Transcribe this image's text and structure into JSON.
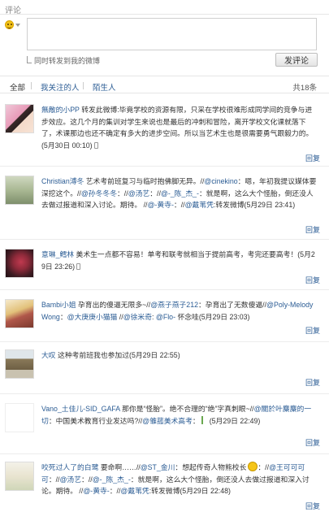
{
  "header": {
    "title": "评论"
  },
  "composer": {
    "placeholder": "",
    "forward_label": "同时转发到我的微博",
    "submit_label": "发评论"
  },
  "filters": {
    "all": "全部",
    "following": "我关注的人",
    "strangers": "陌生人",
    "total": "共18条"
  },
  "reply_label": "回复",
  "comments": [
    {
      "user": "無敵的小PP",
      "text": " 转发此微博:毕竟学校的资源有限，只采在学校很难形成同学间的竞争与进步效应。这几个月的集训对学生来说也是最后的冲刺和冒险，离开学校文化课就落下了，术课那边也还不确定有多大的进步空间。所以当艺术生也是很需要勇气跟毅力的。",
      "time": "(5月30日 00:10)"
    },
    {
      "user": "Christian溥冬",
      "p1": " 艺术考前班复习与临时抱佛脚无异。//",
      "m1": "@cinekino",
      "p2": "：嗯，年初我提议媒体要深挖这个。//",
      "m2": "@孙冬冬冬",
      "p3": "：//",
      "m3": "@汤艺",
      "p4": "：//",
      "m4": "@-_陈_杰_-",
      "p5": "：就是啊，这么大个怪胎，倒还没人去做过报道和深入讨论。期待。 //",
      "m5": "@-黄寺-",
      "p6": "：//",
      "m6": "@戴苇凭",
      "p7": ":转发微博",
      "time": "(5月29日 23:41)"
    },
    {
      "user": "意琳_鳕林",
      "text": " 美术生一点都不容易！单考和联考就相当于提前高考，考完还要高考！",
      "time": "(5月29日 23:26)"
    },
    {
      "user": "Bambi小姐",
      "p1": " 孕育出的傻逼无限多~//",
      "m1": "@燕子燕子212",
      "p2": "：孕育出了无数傻逼//",
      "m2": "@Poly-MelodyWong",
      "p3": "：",
      "m3": "@大庚庚小猫猫",
      "p4": " //",
      "m4": "@徐米奇",
      "p5": ": ",
      "m5": "@Flo-",
      "p6": " 怀念哇",
      "time": "(5月29日 23:03)"
    },
    {
      "user": "大叹",
      "text": " 这种考前班我也参加过",
      "time": "(5月29日 22:55)"
    },
    {
      "user": "Vano_土佳儿-SID_GAFA",
      "p1": " 那你是“怪胎”。绝不合理的“绝”字真刺眼~//",
      "m1": "@關於叶麋麋的一切",
      "p2": "：中国美术教育行业发达吗?//",
      "m2": "@雏菰美术高考",
      "p3": "：",
      "time": "(5月29日 22:49)"
    },
    {
      "user": "咬死过人了的白鹭",
      "p1": " 要命啊……//",
      "m1": "@ST_金川",
      "p2": "：想起传奇人物熊校长",
      "m2": "@王可可可可",
      "p3": "：//",
      "m3": "@汤艺",
      "p4": "：//",
      "m4": "@-_陈_杰_-",
      "p5": "：就是啊，这么大个怪胎，倒还没人去做过报道和深入讨论。期待。 //",
      "m5": "@-黄寺-",
      "p6": "：//",
      "m6": "@戴苇凭",
      "p7": ":转发微博",
      "time": "(5月29日 22:48)"
    }
  ]
}
